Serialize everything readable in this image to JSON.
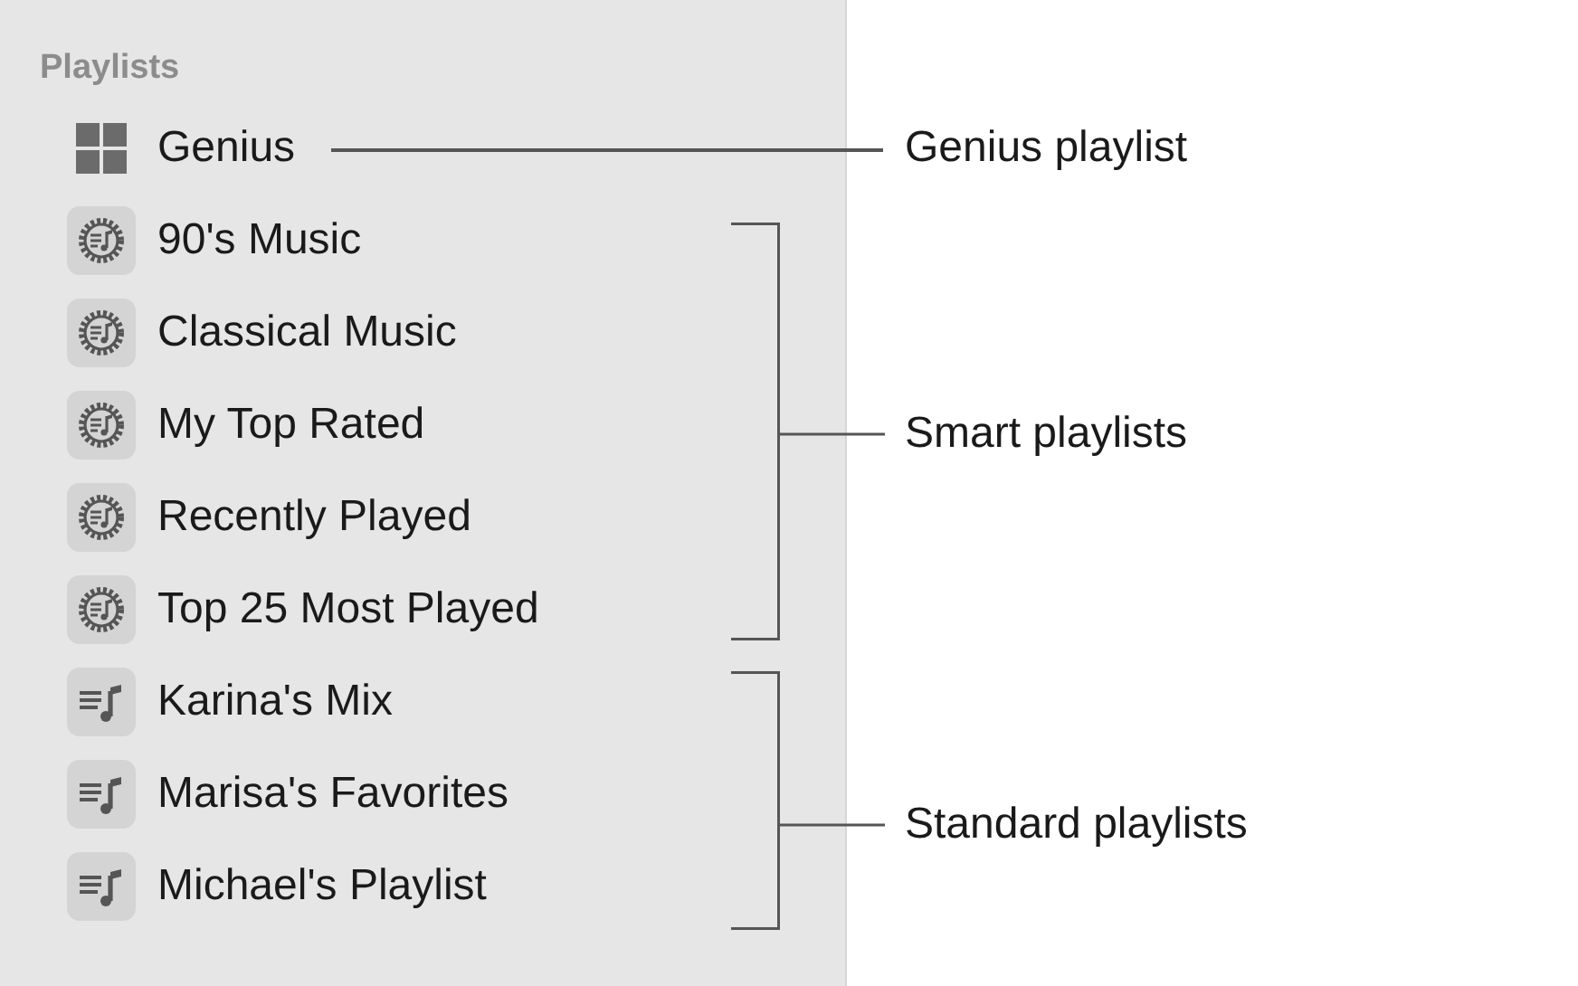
{
  "sidebar": {
    "header": "Playlists",
    "items": [
      {
        "label": "Genius",
        "kind": "genius"
      },
      {
        "label": "90's Music",
        "kind": "smart"
      },
      {
        "label": "Classical Music",
        "kind": "smart"
      },
      {
        "label": "My Top Rated",
        "kind": "smart"
      },
      {
        "label": "Recently Played",
        "kind": "smart"
      },
      {
        "label": "Top 25 Most Played",
        "kind": "smart"
      },
      {
        "label": "Karina's Mix",
        "kind": "standard"
      },
      {
        "label": "Marisa's Favorites",
        "kind": "standard"
      },
      {
        "label": "Michael's Playlist",
        "kind": "standard"
      }
    ]
  },
  "callouts": [
    {
      "label": "Genius playlist",
      "kind": "line"
    },
    {
      "label": "Smart playlists",
      "kind": "bracket"
    },
    {
      "label": "Standard playlists",
      "kind": "bracket"
    }
  ]
}
